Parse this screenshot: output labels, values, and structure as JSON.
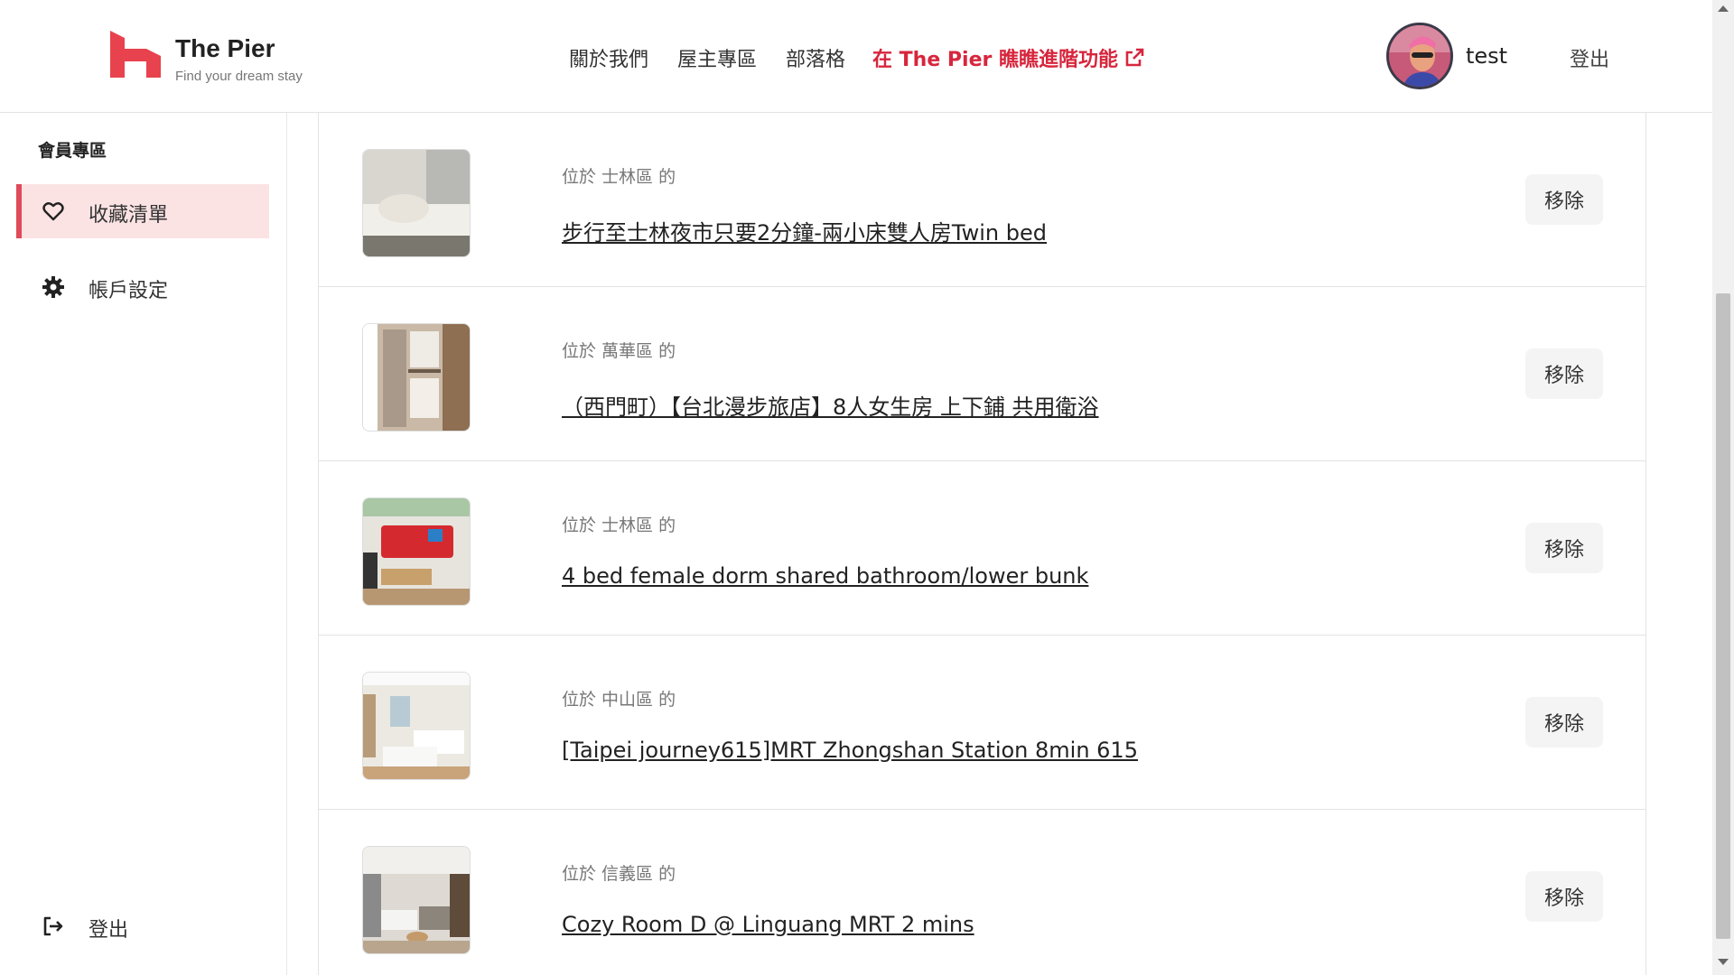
{
  "header": {
    "brand_name": "The Pier",
    "brand_tagline": "Find your dream stay",
    "nav": [
      {
        "label": "關於我們"
      },
      {
        "label": "屋主專區"
      },
      {
        "label": "部落格"
      },
      {
        "label": "在 The Pier 瞧瞧進階功能"
      }
    ],
    "username": "test",
    "logout_label": "登出",
    "accent_color": "#d7263d"
  },
  "sidebar": {
    "title": "會員專區",
    "items": [
      {
        "label": "收藏清單",
        "icon": "heart-icon",
        "active": true
      },
      {
        "label": "帳戶設定",
        "icon": "gear-icon",
        "active": false
      }
    ],
    "logout_label": "登出",
    "logout_icon": "logout-icon"
  },
  "favorites": [
    {
      "location": "位於 士林區 的",
      "title": "步行至士林夜市只要2分鐘-兩小床雙人房Twin bed",
      "remove_label": "移除"
    },
    {
      "location": "位於 萬華區 的",
      "title": "（西門町）【台北漫步旅店】8人女生房 上下鋪 共用衛浴",
      "remove_label": "移除"
    },
    {
      "location": "位於 士林區 的",
      "title": "4 bed female dorm shared bathroom/lower bunk",
      "remove_label": "移除"
    },
    {
      "location": "位於 中山區 的",
      "title": "[Taipei journey615]MRT Zhongshan Station 8min 615",
      "remove_label": "移除"
    },
    {
      "location": "位於 信義區 的",
      "title": "Cozy Room D @ Linguang MRT 2 mins",
      "remove_label": "移除"
    }
  ]
}
